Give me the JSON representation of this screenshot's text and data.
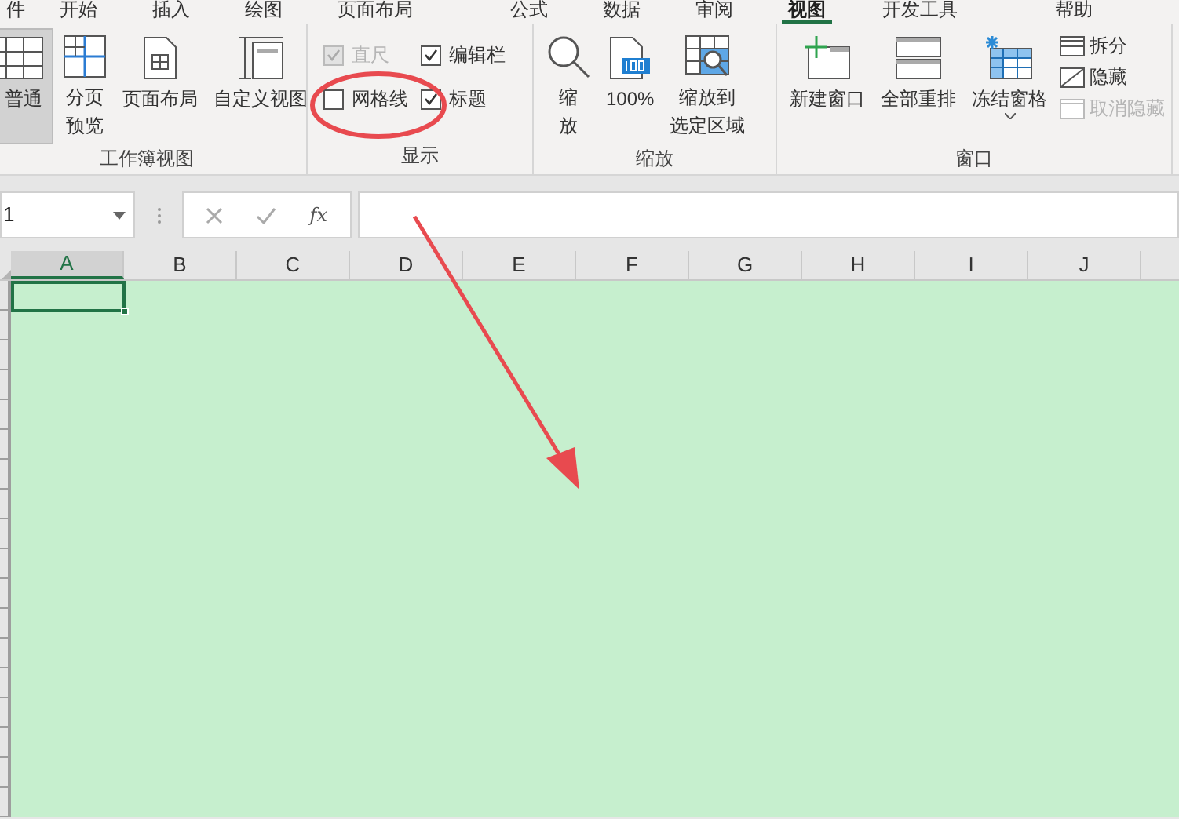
{
  "tabs": [
    {
      "label": "件",
      "selected": false
    },
    {
      "label": "开始",
      "selected": false
    },
    {
      "label": "插入",
      "selected": false
    },
    {
      "label": "绘图",
      "selected": false
    },
    {
      "label": "页面布局",
      "selected": false
    },
    {
      "label": "公式",
      "selected": false
    },
    {
      "label": "数据",
      "selected": false
    },
    {
      "label": "审阅",
      "selected": false
    },
    {
      "label": "视图",
      "selected": true
    },
    {
      "label": "开发工具",
      "selected": false
    },
    {
      "label": "帮助",
      "selected": false
    }
  ],
  "ribbon": {
    "groups": [
      {
        "label": "工作簿视图",
        "items": [
          {
            "kind": "big",
            "label": "普通",
            "selected": true
          },
          {
            "kind": "big",
            "label": "分页预览",
            "selected": false
          },
          {
            "kind": "big",
            "label": "页面布局",
            "selected": false
          },
          {
            "kind": "big",
            "label": "自定义视图",
            "selected": false
          }
        ]
      },
      {
        "label": "显示",
        "items": [
          {
            "kind": "checkbox",
            "label": "直尺",
            "checked": true,
            "disabled": true
          },
          {
            "kind": "checkbox",
            "label": "编辑栏",
            "checked": true,
            "disabled": false
          },
          {
            "kind": "checkbox",
            "label": "网格线",
            "checked": false,
            "disabled": false
          },
          {
            "kind": "checkbox",
            "label": "标题",
            "checked": true,
            "disabled": false
          }
        ]
      },
      {
        "label": "缩放",
        "items": [
          {
            "kind": "big",
            "label": "缩放",
            "selected": false
          },
          {
            "kind": "big",
            "label": "100%",
            "selected": false
          },
          {
            "kind": "big",
            "label": "缩放到选定区域",
            "selected": false
          }
        ]
      },
      {
        "label": "窗口",
        "items": [
          {
            "kind": "big",
            "label": "新建窗口",
            "selected": false
          },
          {
            "kind": "big",
            "label": "全部重排",
            "selected": false
          },
          {
            "kind": "big",
            "label": "冻结窗格",
            "selected": false,
            "dropdown": true
          },
          {
            "kind": "small",
            "label": "拆分",
            "disabled": false
          },
          {
            "kind": "small",
            "label": "隐藏",
            "disabled": false
          },
          {
            "kind": "small",
            "label": "取消隐藏",
            "disabled": true
          }
        ]
      }
    ]
  },
  "formula_bar": {
    "name_box": "1",
    "fx": "fx"
  },
  "columns": [
    {
      "label": "A",
      "selected": true
    },
    {
      "label": "B",
      "selected": false
    },
    {
      "label": "C",
      "selected": false
    },
    {
      "label": "D",
      "selected": false
    },
    {
      "label": "E",
      "selected": false
    },
    {
      "label": "F",
      "selected": false
    },
    {
      "label": "G",
      "selected": false
    },
    {
      "label": "H",
      "selected": false
    },
    {
      "label": "I",
      "selected": false
    },
    {
      "label": "J",
      "selected": false
    }
  ],
  "sheet": {
    "gridlines": false
  }
}
